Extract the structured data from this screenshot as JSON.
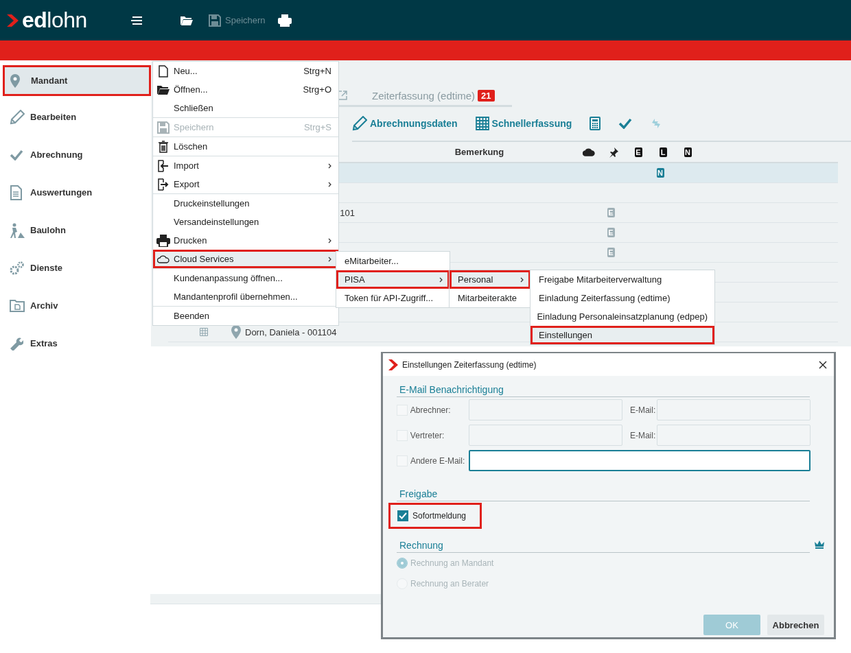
{
  "header": {
    "logo": "**ed**lohn",
    "toolbar": [
      {
        "kind": "menu"
      },
      {
        "kind": "open"
      },
      {
        "kind": "save",
        "label": "Speichern",
        "disabled": true
      },
      {
        "kind": "print"
      }
    ]
  },
  "sidebar": {
    "items": [
      {
        "kind": "pin",
        "label": "Mandant",
        "selected": true
      },
      {
        "kind": "pencil",
        "label": "Bearbeiten",
        "selected": false
      },
      {
        "kind": "check",
        "label": "Abrechnung",
        "selected": false
      },
      {
        "kind": "doc",
        "label": "Auswertungen",
        "selected": false
      },
      {
        "kind": "worker",
        "label": "Baulohn",
        "selected": false
      },
      {
        "kind": "gears",
        "label": "Dienste",
        "selected": false
      },
      {
        "kind": "archive",
        "label": "Archiv",
        "selected": false
      },
      {
        "kind": "wrench",
        "label": "Extras",
        "selected": false
      }
    ]
  },
  "tabs": [
    {
      "label": "Zeiterfassung (edtime)",
      "badge": "21",
      "selected": false
    }
  ],
  "toolbar": [
    {
      "kind": "pencil",
      "label": "Abrechnungsdaten"
    },
    {
      "kind": "grid",
      "label": "Schnellerfassung"
    },
    {
      "kind": "calculator"
    },
    {
      "kind": "check"
    },
    {
      "kind": "sync",
      "disabled": true
    }
  ],
  "table": {
    "columns": [
      {
        "kind": "text",
        "label": "Bemerkung"
      },
      {
        "kind": "cloud"
      },
      {
        "kind": "pin"
      },
      {
        "kind": "letter",
        "label": "E"
      },
      {
        "kind": "letter",
        "label": "L"
      },
      {
        "kind": "letter",
        "label": "N"
      }
    ],
    "rows": [
      {
        "selected": true,
        "n": "N"
      },
      {
        "selected": false
      },
      {
        "selected": false,
        "name": "101",
        "kind": "tail",
        "e": "E"
      },
      {
        "selected": false,
        "e": "E"
      },
      {
        "selected": false,
        "e": "E"
      },
      {
        "selected": false
      },
      {
        "selected": false
      },
      {
        "selected": false
      },
      {
        "selected": false,
        "name": "Dorn, Daniela - 001104",
        "kind": "person"
      }
    ]
  },
  "file_menu": {
    "groups": [
      [
        {
          "kind": "file",
          "label": "Neu...",
          "shortcut": "Strg+N",
          "disabled": false,
          "submenu": false,
          "selected": false
        },
        {
          "kind": "folder",
          "label": "Öffnen...",
          "shortcut": "Strg+O",
          "disabled": false,
          "submenu": false,
          "selected": false
        },
        {
          "label": "Schließen",
          "disabled": false,
          "submenu": false,
          "selected": false
        }
      ],
      [
        {
          "kind": "save",
          "label": "Speichern",
          "shortcut": "Strg+S",
          "disabled": true,
          "submenu": false,
          "selected": false
        }
      ],
      [
        {
          "kind": "trash",
          "label": "Löschen",
          "disabled": false,
          "submenu": false,
          "selected": false
        }
      ],
      [
        {
          "kind": "import",
          "label": "Import",
          "disabled": false,
          "submenu": true,
          "selected": false
        },
        {
          "kind": "export",
          "label": "Export",
          "disabled": false,
          "submenu": true,
          "selected": false
        }
      ],
      [
        {
          "label": "Druckeinstellungen",
          "disabled": false,
          "submenu": false,
          "selected": false
        },
        {
          "label": "Versandeinstellungen",
          "disabled": false,
          "submenu": false,
          "selected": false
        },
        {
          "kind": "print",
          "label": "Drucken",
          "disabled": false,
          "submenu": true,
          "selected": false
        },
        {
          "kind": "cloud",
          "label": "Cloud Services",
          "disabled": false,
          "submenu": true,
          "selected": true
        }
      ],
      [
        {
          "label": "Kundenanpassung öffnen...",
          "disabled": false,
          "submenu": false,
          "selected": false
        },
        {
          "label": "Mandantenprofil übernehmen...",
          "disabled": false,
          "submenu": false,
          "selected": false
        }
      ],
      [
        {
          "label": "Beenden",
          "disabled": false,
          "submenu": false,
          "selected": false
        }
      ]
    ]
  },
  "cloud_menu": {
    "items": [
      {
        "label": "eMitarbeiter...",
        "submenu": false,
        "selected": false
      },
      {
        "label": "PISA",
        "submenu": true,
        "selected": true
      },
      {
        "label": "Token für API-Zugriff...",
        "submenu": false,
        "selected": false
      }
    ]
  },
  "pisa_menu": {
    "items": [
      {
        "label": "Personal",
        "submenu": true,
        "selected": true
      },
      {
        "label": "Mitarbeiterakte",
        "submenu": false,
        "selected": false
      }
    ]
  },
  "personal_menu": {
    "items": [
      {
        "label": "Freigabe Mitarbeiterverwaltung",
        "selected": false
      },
      {
        "label": "Einladung Zeiterfassung (edtime)",
        "selected": false
      },
      {
        "label": "Einladung Personaleinsatzplanung (edpep)",
        "selected": false
      },
      {
        "label": "Einstellungen",
        "selected": true
      }
    ]
  },
  "dialog": {
    "title": "Einstellungen Zeiterfassung (edtime)",
    "email_section": {
      "title": "E-Mail Benachrichtigung",
      "rows": [
        {
          "label": "Abrechner:",
          "checked": false,
          "email_label": "E-Mail:",
          "focused": false
        },
        {
          "label": "Vertreter:",
          "checked": false,
          "email_label": "E-Mail:",
          "focused": false
        },
        {
          "label": "Andere E-Mail:",
          "checked": false,
          "focused": true
        }
      ]
    },
    "release_section": {
      "title": "Freigabe",
      "options": [
        {
          "label": "Sofortmeldung",
          "checked": true,
          "annotated": true
        }
      ]
    },
    "invoice_section": {
      "title": "Rechnung",
      "premium": true,
      "options": [
        {
          "label": "Rechnung an Mandant",
          "selected": true,
          "disabled": true
        },
        {
          "label": "Rechnung an Berater",
          "selected": false,
          "disabled": true
        }
      ]
    },
    "buttons": [
      {
        "kind": "primary",
        "label": "OK",
        "disabled": true
      },
      {
        "kind": "secondary",
        "label": "Abbrechen"
      }
    ]
  }
}
